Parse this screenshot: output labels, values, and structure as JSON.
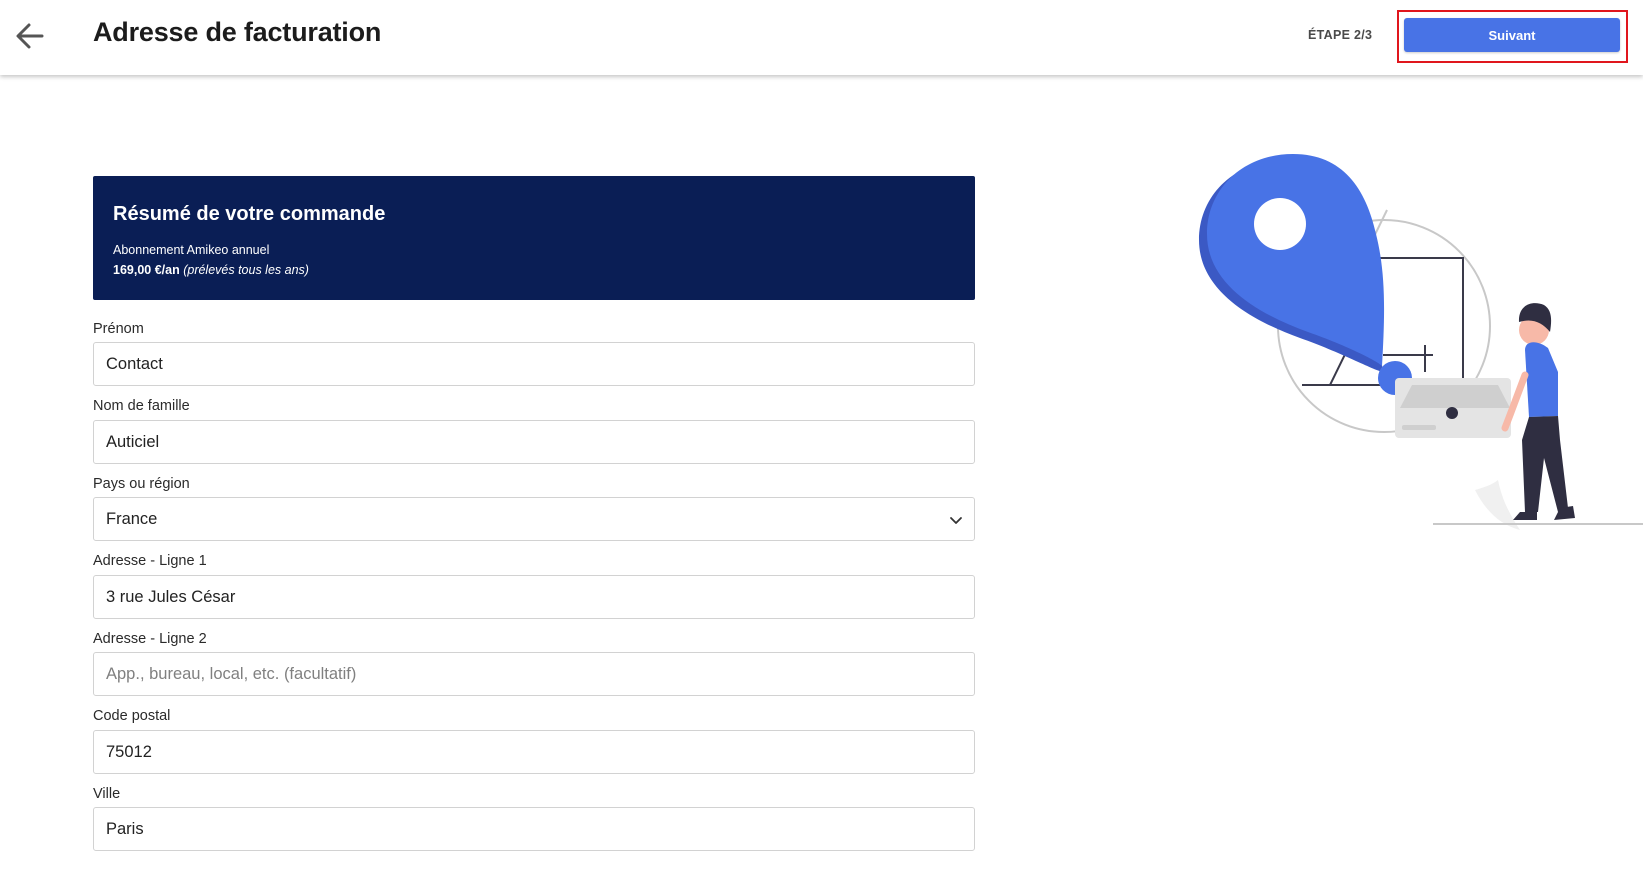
{
  "header": {
    "title": "Adresse de facturation",
    "step": "ÉTAPE 2/3",
    "next_label": "Suivant"
  },
  "summary": {
    "title": "Résumé de votre commande",
    "product": "Abonnement Amikeo annuel",
    "price": "169,00 €/an",
    "billing_note": "(prélevés tous les ans)"
  },
  "form": {
    "first_name": {
      "label": "Prénom",
      "value": "Contact"
    },
    "last_name": {
      "label": "Nom de famille",
      "value": "Auticiel"
    },
    "country": {
      "label": "Pays ou région",
      "value": "France"
    },
    "address1": {
      "label": "Adresse - Ligne 1",
      "value": "3 rue Jules César"
    },
    "address2": {
      "label": "Adresse - Ligne 2",
      "value": "",
      "placeholder": "App., bureau, local, etc. (facultatif)"
    },
    "postal_code": {
      "label": "Code postal",
      "value": "75012"
    },
    "city": {
      "label": "Ville",
      "value": "Paris"
    }
  },
  "icons": {
    "back": "arrow-left-icon",
    "select": "chevron-down-icon"
  },
  "colors": {
    "primary": "#4873e6",
    "summary_bg": "#0a1e55",
    "highlight": "#e0161d"
  }
}
